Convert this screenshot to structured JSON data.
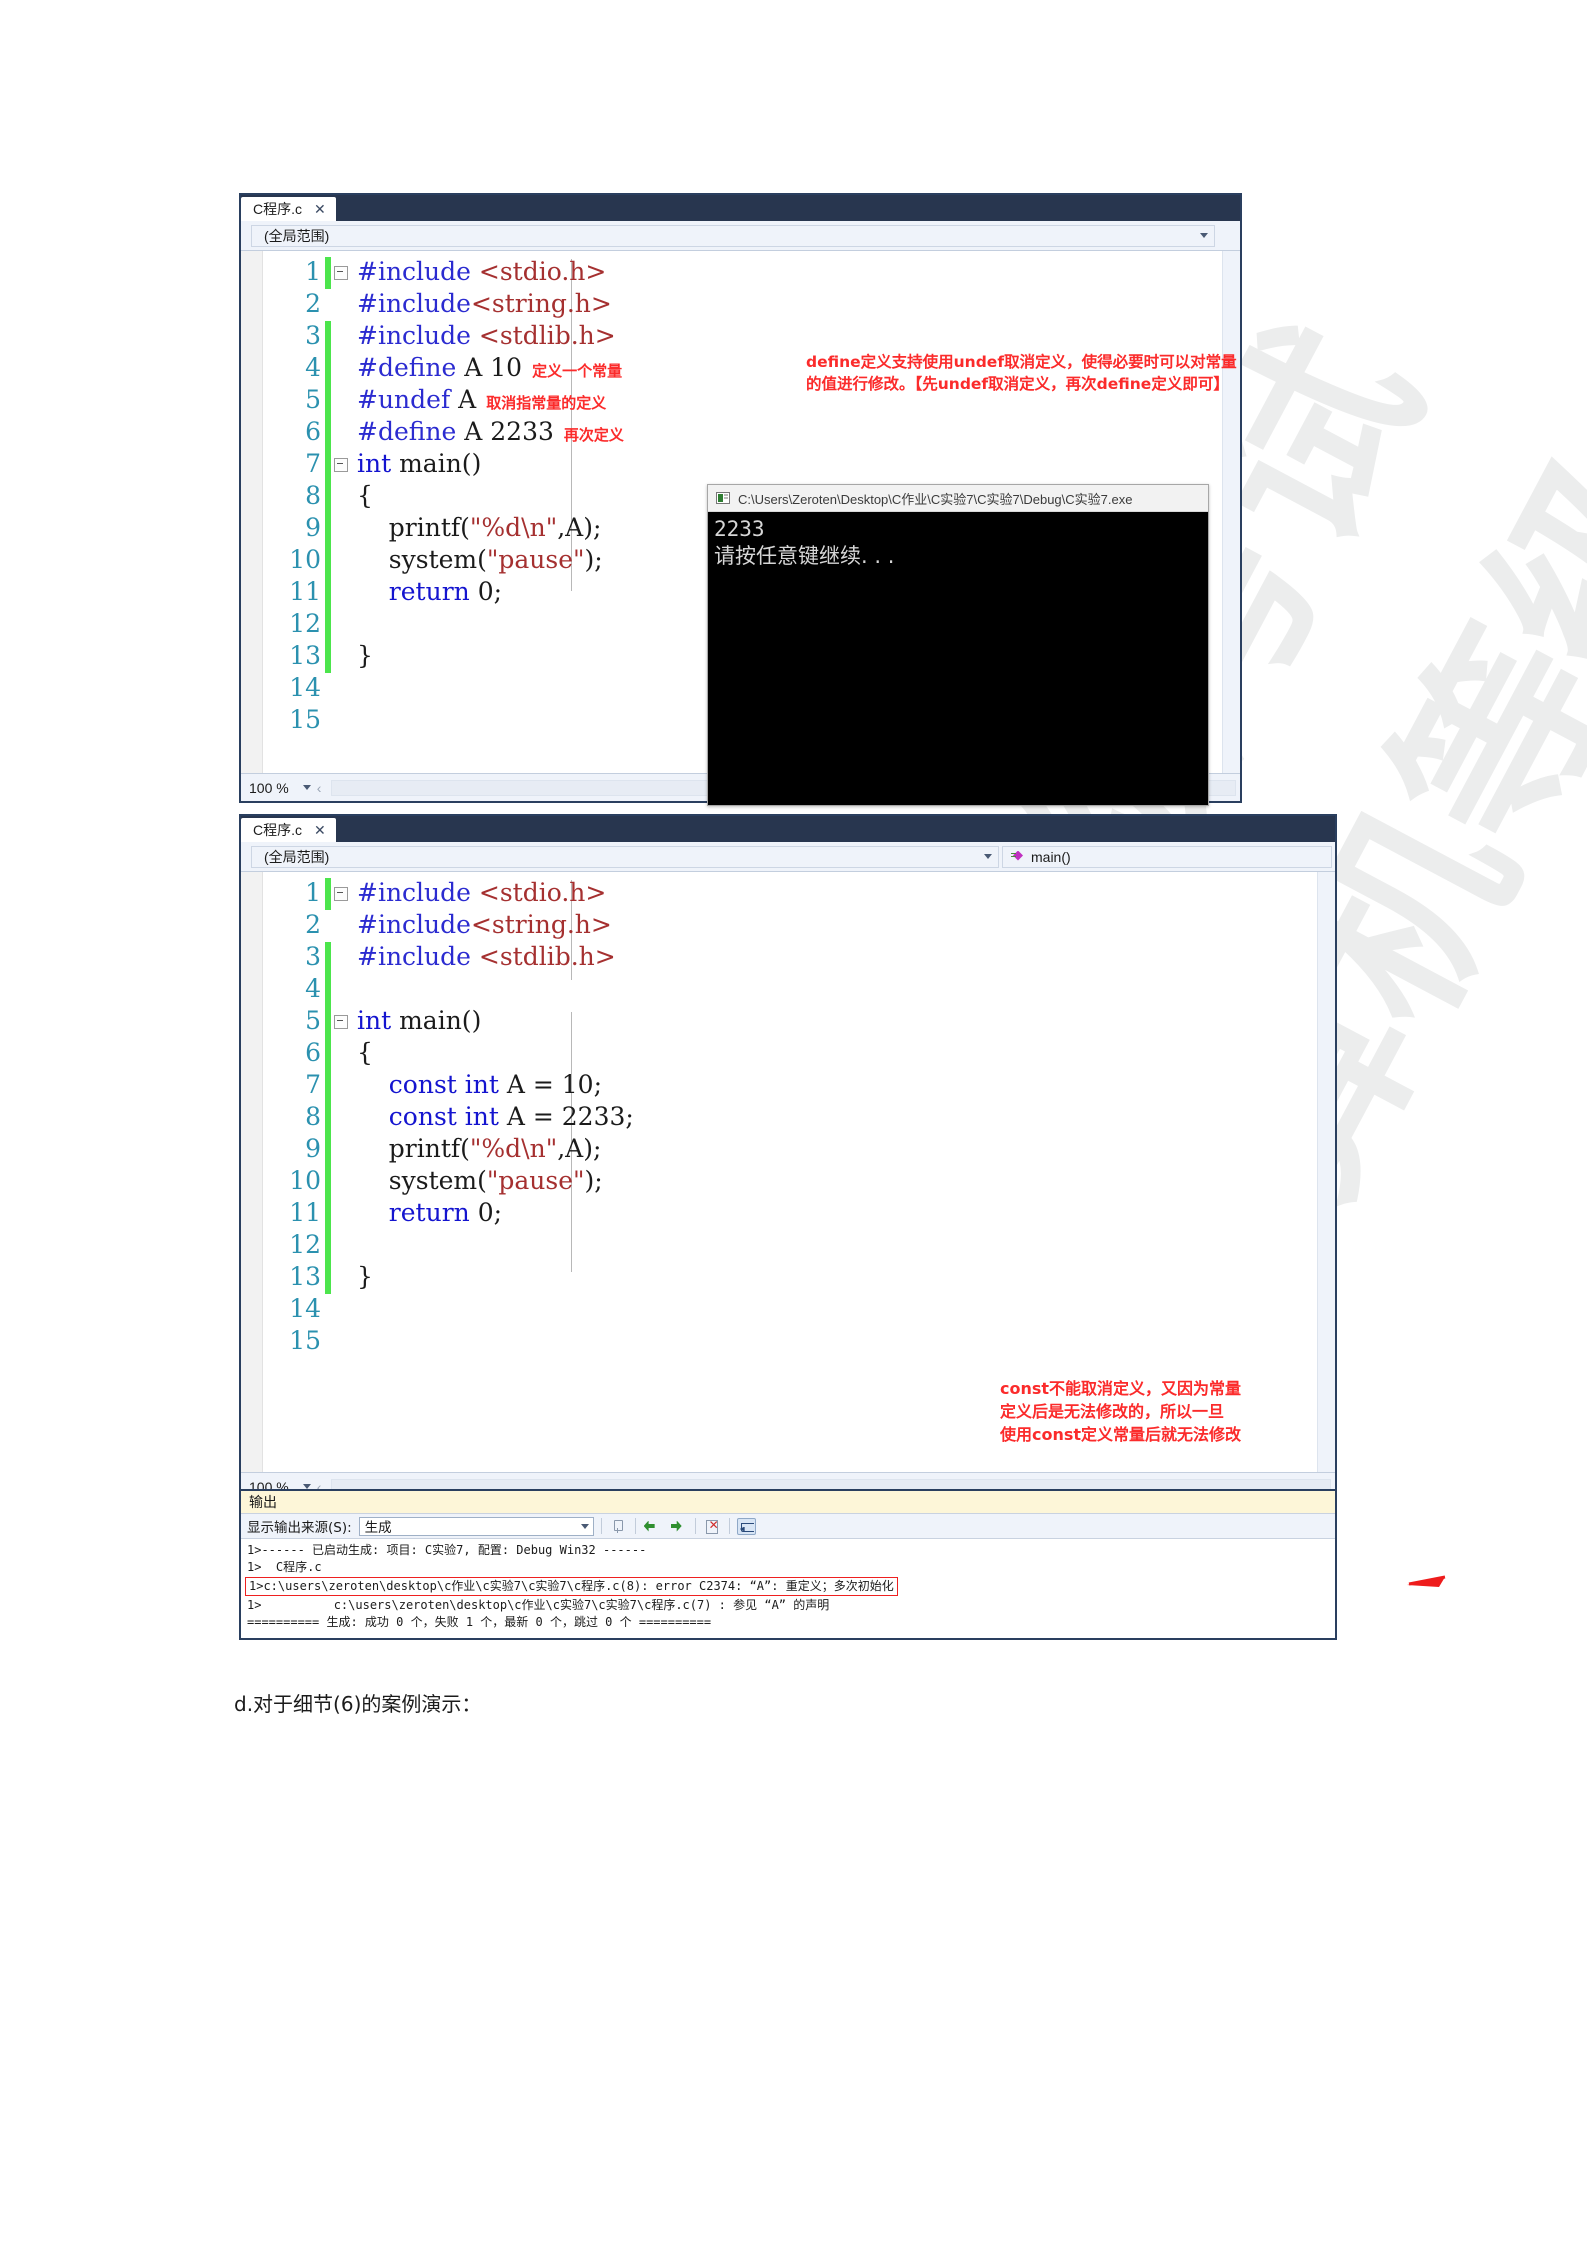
{
  "document": {
    "caption": "d.对于细节(6)的案例演示："
  },
  "watermark": {
    "text": "计算机等级考试",
    "color": "#eceded"
  },
  "editor1": {
    "tab_label": "C程序.c",
    "close_label": "✕",
    "scope_selector": "(全局范围)",
    "zoom_level": "100 %",
    "lines": [
      {
        "num": "1",
        "changed": true,
        "fold": "minus",
        "segments": [
          {
            "t": "#include ",
            "c": "pp"
          },
          {
            "t": "<stdio.h>",
            "c": "str"
          }
        ],
        "annotation": ""
      },
      {
        "num": "2",
        "changed": false,
        "fold": "",
        "segments": [
          {
            "t": "#include",
            "c": "pp"
          },
          {
            "t": "<string.h>",
            "c": "str"
          }
        ],
        "annotation": ""
      },
      {
        "num": "3",
        "changed": true,
        "fold": "",
        "segments": [
          {
            "t": "#include ",
            "c": "pp"
          },
          {
            "t": "<stdlib.h>",
            "c": "str"
          }
        ],
        "annotation": ""
      },
      {
        "num": "4",
        "changed": true,
        "fold": "",
        "segments": [
          {
            "t": "#define",
            "c": "pp"
          },
          {
            "t": " A 10",
            "c": "plain"
          }
        ],
        "annotation": "定义一个常量"
      },
      {
        "num": "5",
        "changed": true,
        "fold": "",
        "segments": [
          {
            "t": "#undef",
            "c": "pp"
          },
          {
            "t": " A",
            "c": "plain"
          }
        ],
        "annotation": "取消指常量的定义"
      },
      {
        "num": "6",
        "changed": true,
        "fold": "",
        "segments": [
          {
            "t": "#define",
            "c": "pp"
          },
          {
            "t": " A 2233",
            "c": "plain"
          }
        ],
        "annotation": "再次定义"
      },
      {
        "num": "7",
        "changed": true,
        "fold": "minus",
        "segments": [
          {
            "t": "int",
            "c": "kw"
          },
          {
            "t": " main()",
            "c": "plain"
          }
        ],
        "annotation": ""
      },
      {
        "num": "8",
        "changed": true,
        "fold": "",
        "segments": [
          {
            "t": "{",
            "c": "plain"
          }
        ],
        "annotation": ""
      },
      {
        "num": "9",
        "changed": true,
        "fold": "",
        "segments": [
          {
            "t": "    printf(",
            "c": "plain"
          },
          {
            "t": "\"%d",
            "c": "str"
          },
          {
            "t": "\\n",
            "c": "esc"
          },
          {
            "t": "\"",
            "c": "str"
          },
          {
            "t": ",A);",
            "c": "plain"
          }
        ],
        "annotation": ""
      },
      {
        "num": "10",
        "changed": true,
        "fold": "",
        "segments": [
          {
            "t": "    system(",
            "c": "plain"
          },
          {
            "t": "\"pause\"",
            "c": "str"
          },
          {
            "t": ");",
            "c": "plain"
          }
        ],
        "annotation": ""
      },
      {
        "num": "11",
        "changed": true,
        "fold": "",
        "segments": [
          {
            "t": "    ",
            "c": "plain"
          },
          {
            "t": "return",
            "c": "kw"
          },
          {
            "t": " 0;",
            "c": "plain"
          }
        ],
        "annotation": ""
      },
      {
        "num": "12",
        "changed": true,
        "fold": "",
        "segments": [
          {
            "t": "",
            "c": "plain"
          }
        ],
        "annotation": ""
      },
      {
        "num": "13",
        "changed": true,
        "fold": "",
        "segments": [
          {
            "t": "}",
            "c": "plain"
          }
        ],
        "annotation": ""
      },
      {
        "num": "14",
        "changed": false,
        "fold": "",
        "segments": [
          {
            "t": "",
            "c": "plain"
          }
        ],
        "annotation": ""
      },
      {
        "num": "15",
        "changed": false,
        "fold": "",
        "segments": [
          {
            "t": "",
            "c": "plain"
          }
        ],
        "annotation": ""
      }
    ]
  },
  "callout1": "define定义支持使用undef取消定义，使得必要时可以对常量\n的值进行修改。【先undef取消定义，再次define定义即可】",
  "console": {
    "title": "C:\\Users\\Zeroten\\Desktop\\C作业\\C实验7\\C实验7\\Debug\\C实验7.exe",
    "icon": "console-app-icon",
    "output_line1": "2233",
    "output_line2": "请按任意键继续. . ."
  },
  "editor2": {
    "tab_label": "C程序.c",
    "close_label": "✕",
    "scope_selector": "(全局范围)",
    "member_selector": "main()",
    "zoom_level": "100 %",
    "lines": [
      {
        "num": "1",
        "changed": true,
        "fold": "minus",
        "segments": [
          {
            "t": "#include ",
            "c": "pp"
          },
          {
            "t": "<stdio.h>",
            "c": "str"
          }
        ]
      },
      {
        "num": "2",
        "changed": false,
        "fold": "",
        "segments": [
          {
            "t": "#include",
            "c": "pp"
          },
          {
            "t": "<string.h>",
            "c": "str"
          }
        ]
      },
      {
        "num": "3",
        "changed": true,
        "fold": "",
        "segments": [
          {
            "t": "#include ",
            "c": "pp"
          },
          {
            "t": "<stdlib.h>",
            "c": "str"
          }
        ]
      },
      {
        "num": "4",
        "changed": true,
        "fold": "",
        "segments": [
          {
            "t": "",
            "c": "plain"
          }
        ]
      },
      {
        "num": "5",
        "changed": true,
        "fold": "minus",
        "segments": [
          {
            "t": "int",
            "c": "kw"
          },
          {
            "t": " main()",
            "c": "plain"
          }
        ]
      },
      {
        "num": "6",
        "changed": true,
        "fold": "",
        "segments": [
          {
            "t": "{",
            "c": "plain"
          }
        ]
      },
      {
        "num": "7",
        "changed": true,
        "fold": "",
        "segments": [
          {
            "t": "    ",
            "c": "plain"
          },
          {
            "t": "const int",
            "c": "kw"
          },
          {
            "t": " A = 10;",
            "c": "plain"
          }
        ]
      },
      {
        "num": "8",
        "changed": true,
        "fold": "",
        "segments": [
          {
            "t": "    ",
            "c": "plain"
          },
          {
            "t": "const int",
            "c": "kw"
          },
          {
            "t": " A = 2233;",
            "c": "plain"
          }
        ]
      },
      {
        "num": "9",
        "changed": true,
        "fold": "",
        "segments": [
          {
            "t": "    printf(",
            "c": "plain"
          },
          {
            "t": "\"%d",
            "c": "str"
          },
          {
            "t": "\\n",
            "c": "esc"
          },
          {
            "t": "\"",
            "c": "str"
          },
          {
            "t": ",A);",
            "c": "plain"
          }
        ]
      },
      {
        "num": "10",
        "changed": true,
        "fold": "",
        "segments": [
          {
            "t": "    system(",
            "c": "plain"
          },
          {
            "t": "\"pause\"",
            "c": "str"
          },
          {
            "t": ");",
            "c": "plain"
          }
        ]
      },
      {
        "num": "11",
        "changed": true,
        "fold": "",
        "segments": [
          {
            "t": "    ",
            "c": "plain"
          },
          {
            "t": "return",
            "c": "kw"
          },
          {
            "t": " 0;",
            "c": "plain"
          }
        ]
      },
      {
        "num": "12",
        "changed": true,
        "fold": "",
        "segments": [
          {
            "t": "",
            "c": "plain"
          }
        ]
      },
      {
        "num": "13",
        "changed": true,
        "fold": "",
        "segments": [
          {
            "t": "}",
            "c": "plain"
          }
        ]
      },
      {
        "num": "14",
        "changed": false,
        "fold": "",
        "segments": [
          {
            "t": "",
            "c": "plain"
          }
        ]
      },
      {
        "num": "15",
        "changed": false,
        "fold": "",
        "segments": [
          {
            "t": "",
            "c": "plain"
          }
        ]
      }
    ]
  },
  "callout2": "const不能取消定义，又因为常量\n定义后是无法修改的，所以一旦\n使用const定义常量后就无法修改",
  "output_panel": {
    "title": "输出",
    "source_label": "显示输出来源(S):",
    "source_value": "生成",
    "toolbar_icons": [
      "pin-icon",
      "find-previous-icon",
      "find-next-icon",
      "clear-all-icon",
      "word-wrap-icon"
    ],
    "lines": [
      {
        "text": "1>------ 已启动生成: 项目: C实验7, 配置: Debug Win32 ------",
        "boxed": false
      },
      {
        "text": "1>  C程序.c",
        "boxed": false
      },
      {
        "text": "1>c:\\users\\zeroten\\desktop\\c作业\\c实验7\\c实验7\\c程序.c(8): error C2374: “A”: 重定义；多次初始化",
        "boxed": true
      },
      {
        "text": "1>          c:\\users\\zeroten\\desktop\\c作业\\c实验7\\c实验7\\c程序.c(7) : 参见 “A” 的声明",
        "boxed": false
      },
      {
        "text": "========== 生成: 成功 0 个，失败 1 个，最新 0 个，跳过 0 个 ==========",
        "boxed": false
      }
    ],
    "error_arrow": "red-arrow-icon"
  },
  "colors": {
    "annotation_red": "#fb2b2b",
    "keyword_blue": "#1414cf",
    "string_red": "#a53030",
    "linenum_teal": "#2b91af",
    "change_green": "#4ce54c",
    "window_chrome": "#2a3f5f"
  }
}
